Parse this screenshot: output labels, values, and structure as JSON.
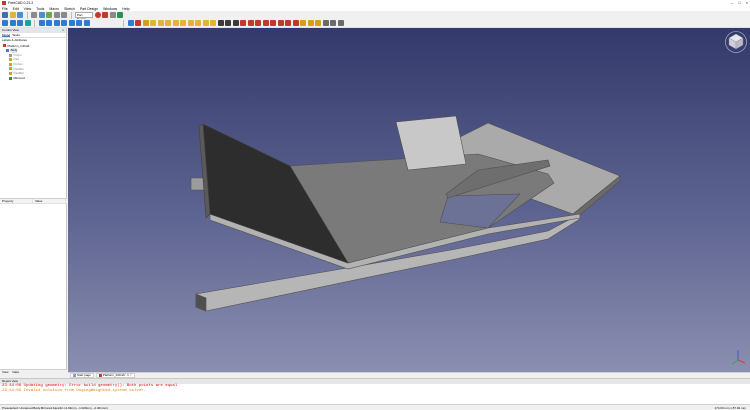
{
  "window": {
    "title": "FreeCAD 0.21.2",
    "controls": [
      "–",
      "□",
      "×"
    ]
  },
  "menu": [
    "File",
    "Edit",
    "View",
    "Tools",
    "Macro",
    "Sketch",
    "Part Design",
    "Windows",
    "Help"
  ],
  "toolbar": {
    "workbench_selector": "Part Design",
    "icon_colors_1": [
      "#3d6fb5",
      "#e2b23a",
      "#4a8ed6",
      "#8a8a8a",
      "#4a8ed6",
      "#6fa84a",
      "#8a8a8a",
      "#8a8a8a"
    ],
    "icon_colors_2": [
      "#2e7bcf",
      "#2e7bcf",
      "#2e7bcf",
      "#1aa39b",
      "#2e7bcf",
      "#2e7bcf",
      "#2e7bcf",
      "#2e7bcf",
      "#2e7bcf",
      "#2e7bcf",
      "#2e7bcf"
    ],
    "part_icons": [
      "#2e7bcf",
      "#c0392b",
      "#d4a017",
      "#e2b23a",
      "#e2b23a",
      "#e2b23a",
      "#e2b23a",
      "#e2b23a",
      "#e2b23a",
      "#e2b23a",
      "#e2b23a",
      "#e2b23a",
      "#3a3a3a",
      "#3a3a3a",
      "#3a3a3a",
      "#c0392b",
      "#c0392b",
      "#c0392b",
      "#c0392b",
      "#c0392b",
      "#c0392b",
      "#c0392b",
      "#c0392b",
      "#d4a017",
      "#d4a017",
      "#d4a017",
      "#6b6b6b",
      "#6b6b6b",
      "#6b6b6b"
    ]
  },
  "combo": {
    "title": "Combo View",
    "tabs": [
      "Model",
      "Tasks"
    ],
    "section": "Labels & Attributes",
    "tree": [
      {
        "label": "Platform_InDraft",
        "icon_color": "#c0392b",
        "indent": 1,
        "selected": false,
        "dim": false
      },
      {
        "label": "Body",
        "icon_color": "#4a7bd0",
        "indent": 2,
        "selected": true,
        "dim": false
      },
      {
        "label": "Origin",
        "icon_color": "#9a9a9a",
        "indent": 3,
        "selected": false,
        "dim": true
      },
      {
        "label": "Pad",
        "icon_color": "#d4a017",
        "indent": 3,
        "selected": false,
        "dim": true
      },
      {
        "label": "Pocket",
        "icon_color": "#d4a017",
        "indent": 3,
        "selected": false,
        "dim": true
      },
      {
        "label": "Pad001",
        "icon_color": "#d4a017",
        "indent": 3,
        "selected": false,
        "dim": true
      },
      {
        "label": "Pad002",
        "icon_color": "#d4a017",
        "indent": 3,
        "selected": false,
        "dim": true
      },
      {
        "label": "Mirrored",
        "icon_color": "#2f8f4e",
        "indent": 3,
        "selected": false,
        "dim": false
      }
    ],
    "prop_columns": [
      "Property",
      "Value"
    ],
    "bottom_tabs": [
      "View",
      "Data"
    ]
  },
  "doc_tabs": [
    {
      "label": "Start page",
      "type": "doc"
    },
    {
      "label": "Platform_InDraft : 1",
      "type": "model"
    }
  ],
  "report": {
    "title": "Report view",
    "lines": [
      {
        "text": "23:44:08  Updating geometry: Error build geometry(): Both points are equal",
        "kind": "err"
      },
      {
        "text": "23:44:08  Invalid solution from DogLegWeighted-system solver.",
        "kind": "warn"
      }
    ]
  },
  "status": {
    "left": "Preselected: Unnamed.Body.Mirrored.Face32 (-4.94mm, -1.029mm, -2.461mm)",
    "right": "174.63 mm x 87.92 mm"
  },
  "colors": {
    "viewport_top": "#333a6b",
    "viewport_bottom": "#8b8fb0",
    "model_light": "#bcbcbc",
    "model_mid": "#7c7c7c",
    "model_dark": "#2a2a2a"
  }
}
